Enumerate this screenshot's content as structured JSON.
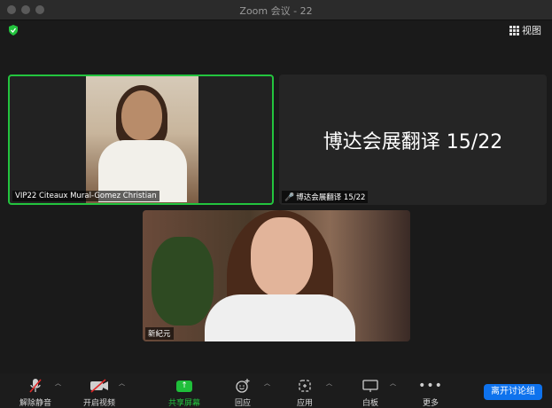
{
  "window": {
    "title": "Zoom 会议 - 22"
  },
  "header": {
    "view_label": "视图"
  },
  "participants": [
    {
      "name": "VIP22 Citeaux Mural-Gomez Christian",
      "active_speaker": true
    },
    {
      "name": "博达会展翻译 15/22",
      "display_name_big": "博达会展翻译 15/22",
      "muted": true
    },
    {
      "name": "新紀元"
    }
  ],
  "toolbar": {
    "unmute": "解除静音",
    "start_video": "开启视频",
    "share_screen": "共享屏幕",
    "reactions": "回应",
    "apps": "应用",
    "whiteboard": "白板",
    "more": "更多",
    "leave_breakout": "离开讨论组"
  },
  "colors": {
    "accent_green": "#23c43e",
    "leave_blue": "#0e72ed",
    "mute_red": "#e02828"
  }
}
